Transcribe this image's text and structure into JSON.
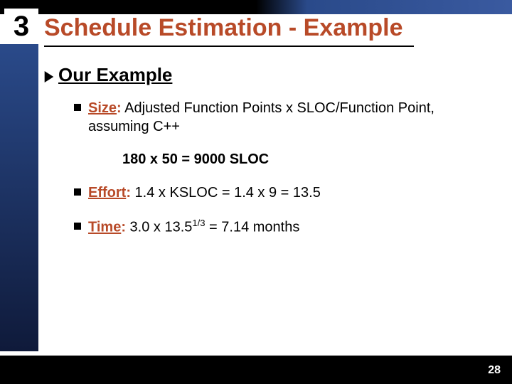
{
  "slide_number_box": "3",
  "title": "Schedule Estimation - Example",
  "heading": "Our Example",
  "bullets": {
    "size": {
      "label": "Size",
      "colon": ":",
      "text_line1": "  Adjusted Function Points x SLOC/Function Point,",
      "text_line2": "assuming C++",
      "calc": "180 x 50 = 9000 SLOC"
    },
    "effort": {
      "label": "Effort",
      "colon": ":",
      "text": "  1.4 x KSLOC = 1.4 x 9 = 13.5"
    },
    "time": {
      "label": "Time",
      "colon": ":",
      "prefix": "  3.0 x 13.5",
      "sup": "1/3",
      "suffix": " = 7.14 months"
    }
  },
  "page_number": "28"
}
